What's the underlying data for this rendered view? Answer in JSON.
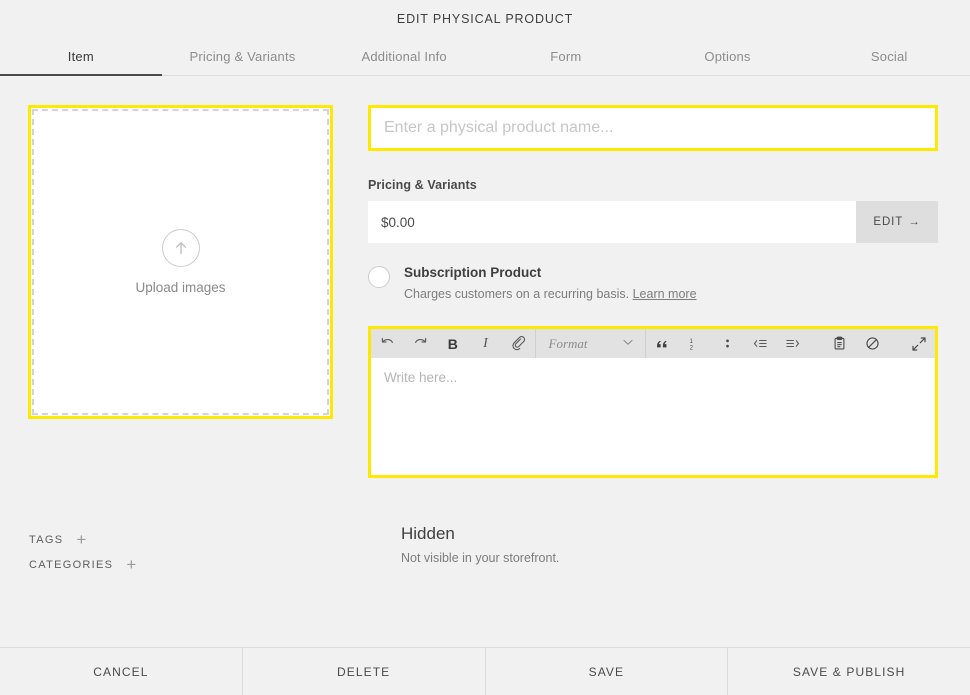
{
  "header": {
    "title": "EDIT PHYSICAL PRODUCT"
  },
  "tabs": [
    {
      "label": "Item",
      "active": true
    },
    {
      "label": "Pricing & Variants",
      "active": false
    },
    {
      "label": "Additional Info",
      "active": false
    },
    {
      "label": "Form",
      "active": false
    },
    {
      "label": "Options",
      "active": false
    },
    {
      "label": "Social",
      "active": false
    }
  ],
  "upload": {
    "label": "Upload images",
    "icon": "arrow-up-circle-icon"
  },
  "taxonomy": [
    {
      "label": "TAGS",
      "add": "+"
    },
    {
      "label": "CATEGORIES",
      "add": "+"
    }
  ],
  "product_name": {
    "value": "",
    "placeholder": "Enter a physical product name..."
  },
  "pricing": {
    "section_label": "Pricing & Variants",
    "price_value": "$0.00",
    "edit_label": "EDIT",
    "edit_arrow": "→"
  },
  "subscription": {
    "title": "Subscription Product",
    "description": "Charges customers on a recurring basis.",
    "link_label": "Learn more",
    "checked": false
  },
  "editor": {
    "placeholder": "Write here...",
    "format_label": "Format",
    "tools": [
      {
        "name": "undo-icon",
        "label": "Undo"
      },
      {
        "name": "redo-icon",
        "label": "Redo"
      },
      {
        "name": "bold-icon",
        "label": "B"
      },
      {
        "name": "italic-icon",
        "label": "I"
      },
      {
        "name": "link-icon",
        "label": "Link"
      },
      {
        "name": "quote-icon",
        "label": "Blockquote"
      },
      {
        "name": "numbered-list-icon",
        "label": "Numbered list"
      },
      {
        "name": "bulleted-list-icon",
        "label": "Bulleted list"
      },
      {
        "name": "outdent-icon",
        "label": "Outdent"
      },
      {
        "name": "indent-icon",
        "label": "Indent"
      },
      {
        "name": "paste-icon",
        "label": "Paste"
      },
      {
        "name": "clear-formatting-icon",
        "label": "Clear formatting"
      },
      {
        "name": "expand-icon",
        "label": "Expand"
      }
    ]
  },
  "visibility": {
    "title": "Hidden",
    "description": "Not visible in your storefront."
  },
  "footer": [
    {
      "label": "CANCEL"
    },
    {
      "label": "DELETE"
    },
    {
      "label": "SAVE"
    },
    {
      "label": "SAVE & PUBLISH"
    }
  ],
  "colors": {
    "highlight": "#ffe900",
    "page_bg": "#f1f1f1",
    "toolbar_bg": "#e2e2e2",
    "edit_btn_bg": "#dedede",
    "text": "#4a4a4a",
    "muted": "#8c8c8c"
  }
}
